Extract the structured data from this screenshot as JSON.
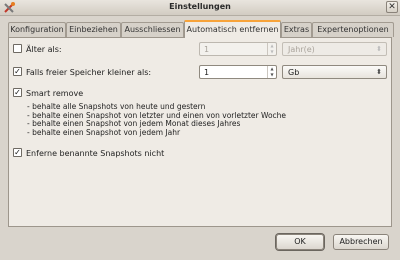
{
  "window": {
    "title": "Einstellungen",
    "close_glyph": "✕"
  },
  "tabs": [
    {
      "label": "Konfiguration"
    },
    {
      "label": "Einbeziehen"
    },
    {
      "label": "Ausschliessen"
    },
    {
      "label": "Automatisch entfernen",
      "active": true
    },
    {
      "label": "Extras"
    },
    {
      "label": "Expertenoptionen"
    }
  ],
  "older_than": {
    "label": "Älter als:",
    "checked": false,
    "value": "1",
    "unit": "Jahr(e)",
    "enabled": false
  },
  "free_space": {
    "label": "Falls freier Speicher kleiner als:",
    "checked": true,
    "value": "1",
    "unit": "Gb",
    "enabled": true
  },
  "smart_remove": {
    "label": "Smart remove",
    "checked": true,
    "rules": [
      "- behalte alle Snapshots von heute und gestern",
      "- behalte einen Snapshot von letzter und einen von vorletzter Woche",
      "- behalte einen Snapshot von jedem Monat dieses Jahres",
      "- behalte einen Snapshot von jedem Jahr"
    ]
  },
  "remove_named": {
    "label": "Enferne benannte Snapshots nicht",
    "checked": true
  },
  "buttons": {
    "ok": "OK",
    "cancel": "Abbrechen"
  },
  "colors": {
    "active_tab_accent": "#f7a33a",
    "window_bg": "#d9d4cc",
    "panel_bg": "#efebe5"
  },
  "icons": {
    "app": "app-tools-icon",
    "close": "close-icon",
    "check": "check-mark-icon",
    "spin": "spin-arrows-icon",
    "combo": "chevron-updown-icon"
  }
}
